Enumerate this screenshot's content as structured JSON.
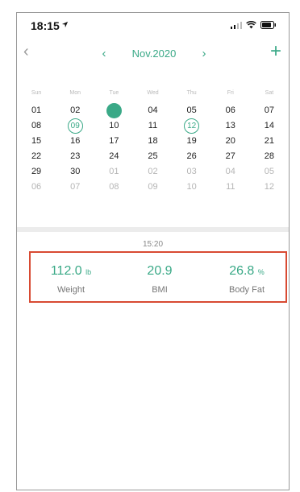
{
  "status_bar": {
    "time": "18:15"
  },
  "nav": {
    "month": "Nov.2020",
    "back_icon": "chevron-left-icon",
    "prev_icon": "chevron-left-icon",
    "next_icon": "chevron-right-icon",
    "add_icon": "plus-icon"
  },
  "calendar": {
    "weekdays": [
      "Sun",
      "Mon",
      "Tue",
      "Wed",
      "Thu",
      "Fri",
      "Sat"
    ],
    "weeks": [
      [
        "01",
        "02",
        "03",
        "04",
        "05",
        "06",
        "07"
      ],
      [
        "08",
        "09",
        "10",
        "11",
        "12",
        "13",
        "14"
      ],
      [
        "15",
        "16",
        "17",
        "18",
        "19",
        "20",
        "21"
      ],
      [
        "22",
        "23",
        "24",
        "25",
        "26",
        "27",
        "28"
      ],
      [
        "29",
        "30",
        "01",
        "02",
        "03",
        "04",
        "05"
      ],
      [
        "06",
        "07",
        "08",
        "09",
        "10",
        "11",
        "12"
      ]
    ],
    "selected_day": "03",
    "marked_days": [
      "09",
      "12"
    ]
  },
  "record": {
    "time": "15:20",
    "weight": {
      "value": "112.0",
      "unit": "lb",
      "label": "Weight"
    },
    "bmi": {
      "value": "20.9",
      "label": "BMI"
    },
    "body_fat": {
      "value": "26.8",
      "unit": "%",
      "label": "Body Fat"
    }
  },
  "colors": {
    "accent": "#3aa987",
    "highlight_border": "#d84a32"
  }
}
